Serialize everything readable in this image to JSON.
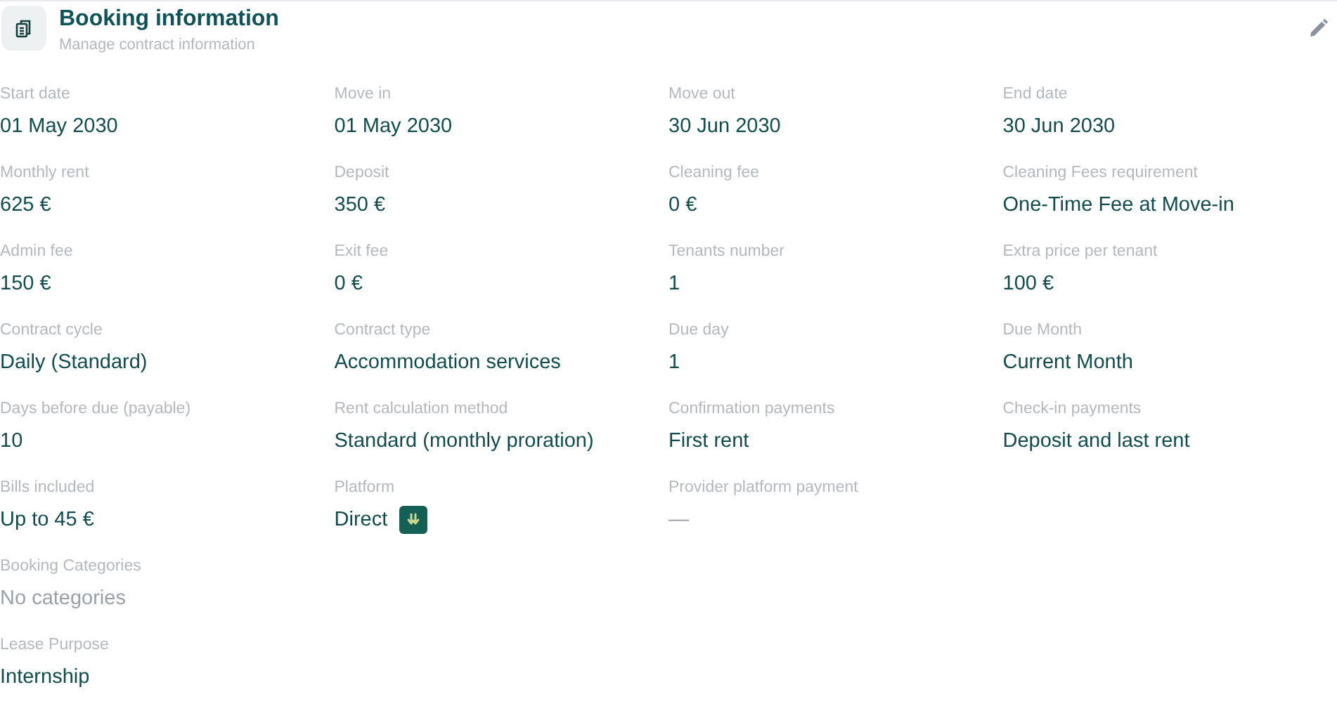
{
  "header": {
    "title": "Booking information",
    "subtitle": "Manage contract information"
  },
  "rows": [
    [
      {
        "label": "Start date",
        "value": "01 May 2030",
        "kind": "text",
        "empty": false
      },
      {
        "label": "Move in",
        "value": "01 May 2030",
        "kind": "text",
        "empty": false
      },
      {
        "label": "Move out",
        "value": "30 Jun 2030",
        "kind": "text",
        "empty": false
      },
      {
        "label": "End date",
        "value": "30 Jun 2030",
        "kind": "text",
        "empty": false
      }
    ],
    [
      {
        "label": "Monthly rent",
        "value": "625 €",
        "kind": "text",
        "empty": false
      },
      {
        "label": "Deposit",
        "value": "350 €",
        "kind": "text",
        "empty": false
      },
      {
        "label": "Cleaning fee",
        "value": "0 €",
        "kind": "text",
        "empty": false
      },
      {
        "label": "Cleaning Fees requirement",
        "value": "One-Time Fee at Move-in",
        "kind": "text",
        "empty": false
      }
    ],
    [
      {
        "label": "Admin fee",
        "value": "150 €",
        "kind": "text",
        "empty": false
      },
      {
        "label": "Exit fee",
        "value": "0 €",
        "kind": "text",
        "empty": false
      },
      {
        "label": "Tenants number",
        "value": "1",
        "kind": "text",
        "empty": false
      },
      {
        "label": "Extra price per tenant",
        "value": "100 €",
        "kind": "text",
        "empty": false
      }
    ],
    [
      {
        "label": "Contract cycle",
        "value": "Daily (Standard)",
        "kind": "text",
        "empty": false
      },
      {
        "label": "Contract type",
        "value": "Accommodation services",
        "kind": "text",
        "empty": false
      },
      {
        "label": "Due day",
        "value": "1",
        "kind": "text",
        "empty": false
      },
      {
        "label": "Due Month",
        "value": "Current Month",
        "kind": "text",
        "empty": false
      }
    ],
    [
      {
        "label": "Days before due (payable)",
        "value": "10",
        "kind": "text",
        "empty": false
      },
      {
        "label": "Rent calculation method",
        "value": "Standard (monthly proration)",
        "kind": "text",
        "empty": false
      },
      {
        "label": "Confirmation payments",
        "value": "First rent",
        "kind": "text",
        "empty": false
      },
      {
        "label": "Check-in payments",
        "value": "Deposit and last rent",
        "kind": "text",
        "empty": false
      }
    ],
    [
      {
        "label": "Bills included",
        "value": "Up to 45 €",
        "kind": "text",
        "empty": false
      },
      {
        "label": "Platform",
        "value": "Direct",
        "kind": "badge",
        "empty": false
      },
      {
        "label": "Provider platform payment",
        "value": "—",
        "kind": "text",
        "empty": true
      }
    ],
    [
      {
        "label": "Booking Categories",
        "value": "No categories",
        "kind": "text",
        "empty": true
      }
    ],
    [
      {
        "label": "Lease Purpose",
        "value": "Internship",
        "kind": "text",
        "empty": false
      }
    ]
  ]
}
